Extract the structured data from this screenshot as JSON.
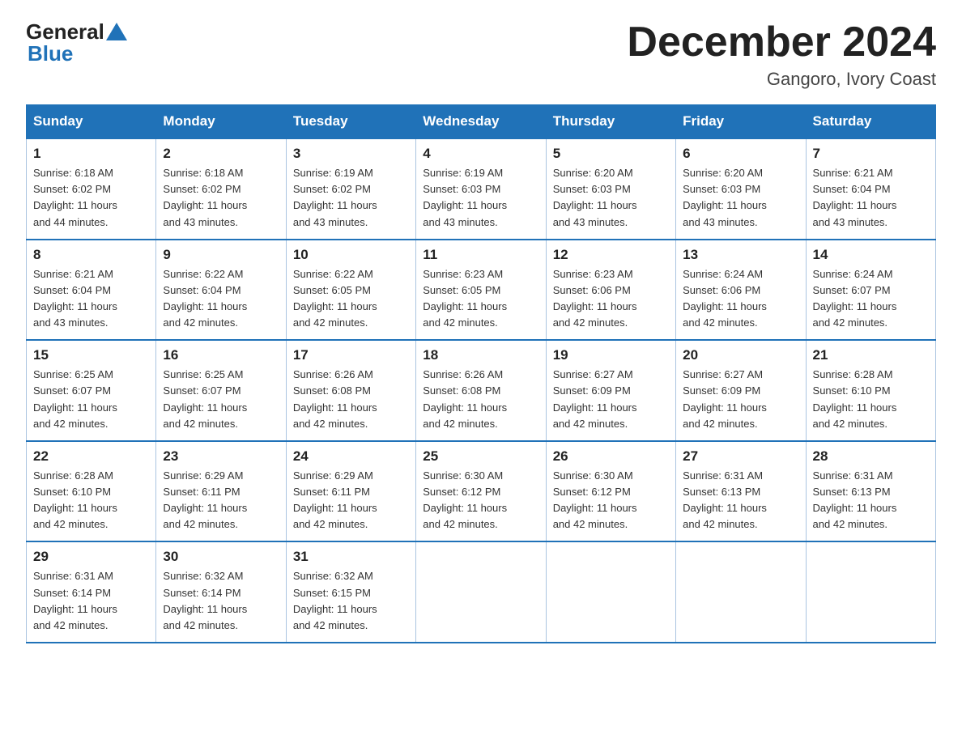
{
  "header": {
    "logo_general": "General",
    "logo_blue": "Blue",
    "month_title": "December 2024",
    "location": "Gangoro, Ivory Coast"
  },
  "weekdays": [
    "Sunday",
    "Monday",
    "Tuesday",
    "Wednesday",
    "Thursday",
    "Friday",
    "Saturday"
  ],
  "weeks": [
    [
      {
        "day": "1",
        "sunrise": "6:18 AM",
        "sunset": "6:02 PM",
        "daylight": "11 hours and 44 minutes."
      },
      {
        "day": "2",
        "sunrise": "6:18 AM",
        "sunset": "6:02 PM",
        "daylight": "11 hours and 43 minutes."
      },
      {
        "day": "3",
        "sunrise": "6:19 AM",
        "sunset": "6:02 PM",
        "daylight": "11 hours and 43 minutes."
      },
      {
        "day": "4",
        "sunrise": "6:19 AM",
        "sunset": "6:03 PM",
        "daylight": "11 hours and 43 minutes."
      },
      {
        "day": "5",
        "sunrise": "6:20 AM",
        "sunset": "6:03 PM",
        "daylight": "11 hours and 43 minutes."
      },
      {
        "day": "6",
        "sunrise": "6:20 AM",
        "sunset": "6:03 PM",
        "daylight": "11 hours and 43 minutes."
      },
      {
        "day": "7",
        "sunrise": "6:21 AM",
        "sunset": "6:04 PM",
        "daylight": "11 hours and 43 minutes."
      }
    ],
    [
      {
        "day": "8",
        "sunrise": "6:21 AM",
        "sunset": "6:04 PM",
        "daylight": "11 hours and 43 minutes."
      },
      {
        "day": "9",
        "sunrise": "6:22 AM",
        "sunset": "6:04 PM",
        "daylight": "11 hours and 42 minutes."
      },
      {
        "day": "10",
        "sunrise": "6:22 AM",
        "sunset": "6:05 PM",
        "daylight": "11 hours and 42 minutes."
      },
      {
        "day": "11",
        "sunrise": "6:23 AM",
        "sunset": "6:05 PM",
        "daylight": "11 hours and 42 minutes."
      },
      {
        "day": "12",
        "sunrise": "6:23 AM",
        "sunset": "6:06 PM",
        "daylight": "11 hours and 42 minutes."
      },
      {
        "day": "13",
        "sunrise": "6:24 AM",
        "sunset": "6:06 PM",
        "daylight": "11 hours and 42 minutes."
      },
      {
        "day": "14",
        "sunrise": "6:24 AM",
        "sunset": "6:07 PM",
        "daylight": "11 hours and 42 minutes."
      }
    ],
    [
      {
        "day": "15",
        "sunrise": "6:25 AM",
        "sunset": "6:07 PM",
        "daylight": "11 hours and 42 minutes."
      },
      {
        "day": "16",
        "sunrise": "6:25 AM",
        "sunset": "6:07 PM",
        "daylight": "11 hours and 42 minutes."
      },
      {
        "day": "17",
        "sunrise": "6:26 AM",
        "sunset": "6:08 PM",
        "daylight": "11 hours and 42 minutes."
      },
      {
        "day": "18",
        "sunrise": "6:26 AM",
        "sunset": "6:08 PM",
        "daylight": "11 hours and 42 minutes."
      },
      {
        "day": "19",
        "sunrise": "6:27 AM",
        "sunset": "6:09 PM",
        "daylight": "11 hours and 42 minutes."
      },
      {
        "day": "20",
        "sunrise": "6:27 AM",
        "sunset": "6:09 PM",
        "daylight": "11 hours and 42 minutes."
      },
      {
        "day": "21",
        "sunrise": "6:28 AM",
        "sunset": "6:10 PM",
        "daylight": "11 hours and 42 minutes."
      }
    ],
    [
      {
        "day": "22",
        "sunrise": "6:28 AM",
        "sunset": "6:10 PM",
        "daylight": "11 hours and 42 minutes."
      },
      {
        "day": "23",
        "sunrise": "6:29 AM",
        "sunset": "6:11 PM",
        "daylight": "11 hours and 42 minutes."
      },
      {
        "day": "24",
        "sunrise": "6:29 AM",
        "sunset": "6:11 PM",
        "daylight": "11 hours and 42 minutes."
      },
      {
        "day": "25",
        "sunrise": "6:30 AM",
        "sunset": "6:12 PM",
        "daylight": "11 hours and 42 minutes."
      },
      {
        "day": "26",
        "sunrise": "6:30 AM",
        "sunset": "6:12 PM",
        "daylight": "11 hours and 42 minutes."
      },
      {
        "day": "27",
        "sunrise": "6:31 AM",
        "sunset": "6:13 PM",
        "daylight": "11 hours and 42 minutes."
      },
      {
        "day": "28",
        "sunrise": "6:31 AM",
        "sunset": "6:13 PM",
        "daylight": "11 hours and 42 minutes."
      }
    ],
    [
      {
        "day": "29",
        "sunrise": "6:31 AM",
        "sunset": "6:14 PM",
        "daylight": "11 hours and 42 minutes."
      },
      {
        "day": "30",
        "sunrise": "6:32 AM",
        "sunset": "6:14 PM",
        "daylight": "11 hours and 42 minutes."
      },
      {
        "day": "31",
        "sunrise": "6:32 AM",
        "sunset": "6:15 PM",
        "daylight": "11 hours and 42 minutes."
      },
      null,
      null,
      null,
      null
    ]
  ],
  "labels": {
    "sunrise": "Sunrise:",
    "sunset": "Sunset:",
    "daylight": "Daylight:"
  }
}
